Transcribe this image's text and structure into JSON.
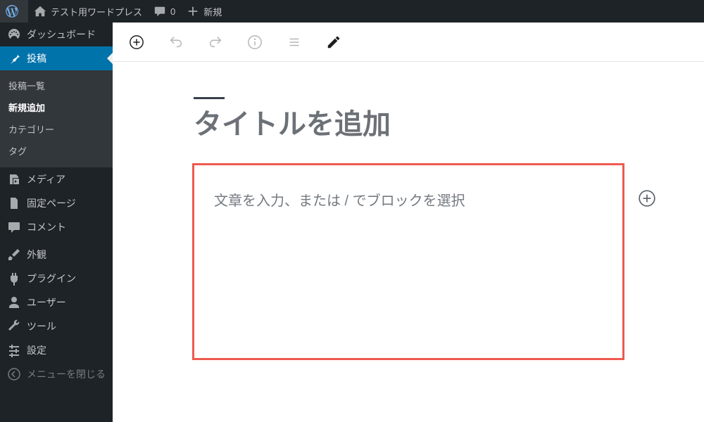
{
  "adminbar": {
    "site_name": "テスト用ワードプレス",
    "comments": "0",
    "new": "新規"
  },
  "sidebar": {
    "dashboard": "ダッシュボード",
    "posts": "投稿",
    "posts_sub": {
      "all": "投稿一覧",
      "new": "新規追加",
      "cats": "カテゴリー",
      "tags": "タグ"
    },
    "media": "メディア",
    "pages": "固定ページ",
    "comments": "コメント",
    "appearance": "外観",
    "plugins": "プラグイン",
    "users": "ユーザー",
    "tools": "ツール",
    "settings": "設定",
    "collapse": "メニューを閉じる"
  },
  "editor": {
    "title_placeholder": "タイトルを追加",
    "content_placeholder": "文章を入力、または / でブロックを選択"
  }
}
